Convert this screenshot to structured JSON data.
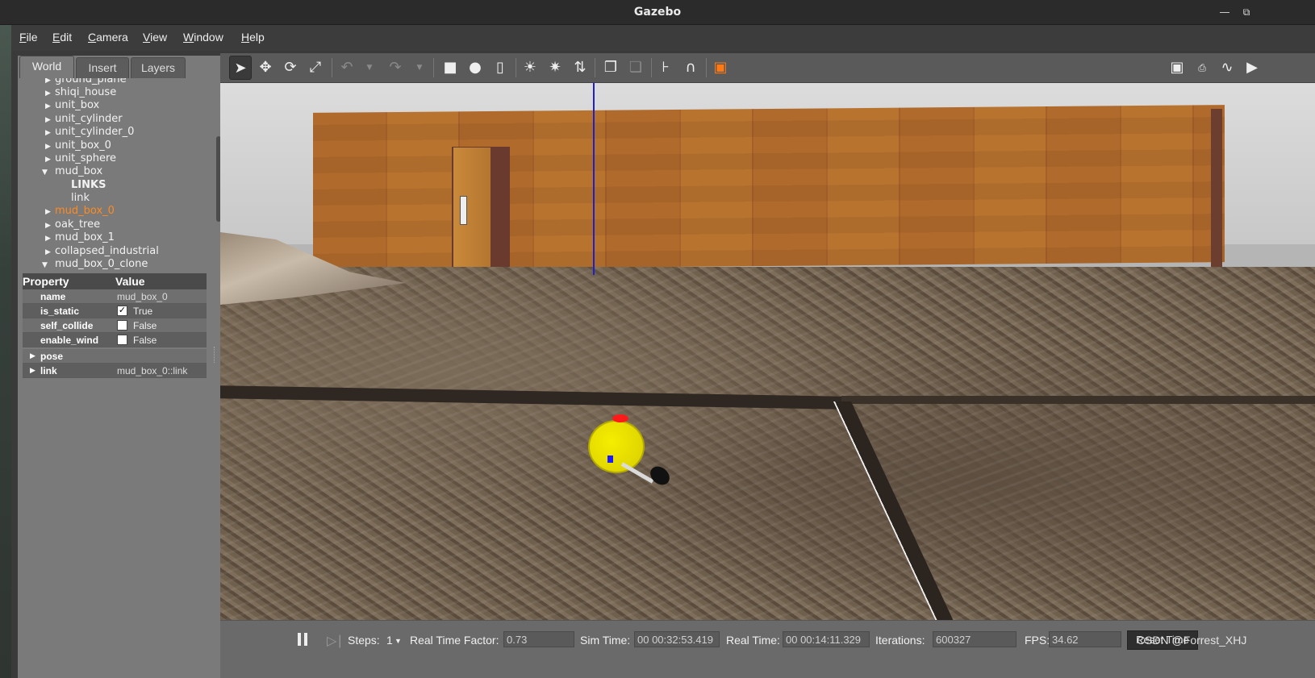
{
  "window": {
    "title": "Gazebo",
    "minimize_glyph": "―",
    "maximize_glyph": "⧉"
  },
  "menu": [
    "File",
    "Edit",
    "Camera",
    "View",
    "Window",
    "Help"
  ],
  "left_panel": {
    "tabs": [
      "World",
      "Insert",
      "Layers"
    ],
    "active_tab": "World",
    "tree": [
      {
        "label": "ground_plane",
        "expanded": false,
        "indent": 0
      },
      {
        "label": "shiqi_house",
        "expanded": false,
        "indent": 0
      },
      {
        "label": "unit_box",
        "expanded": false,
        "indent": 0
      },
      {
        "label": "unit_cylinder",
        "expanded": false,
        "indent": 0
      },
      {
        "label": "unit_cylinder_0",
        "expanded": false,
        "indent": 0
      },
      {
        "label": "unit_box_0",
        "expanded": false,
        "indent": 0
      },
      {
        "label": "unit_sphere",
        "expanded": false,
        "indent": 0
      },
      {
        "label": "mud_box",
        "expanded": true,
        "indent": 0
      },
      {
        "label": "LINKS",
        "indent": 1,
        "bold": true
      },
      {
        "label": "link",
        "indent": 1
      },
      {
        "label": "mud_box_0",
        "expanded": false,
        "indent": 0,
        "selected": true
      },
      {
        "label": "oak_tree",
        "expanded": false,
        "indent": 0
      },
      {
        "label": "mud_box_1",
        "expanded": false,
        "indent": 0
      },
      {
        "label": "collapsed_industrial",
        "expanded": false,
        "indent": 0
      },
      {
        "label": "mud_box_0_clone",
        "expanded": true,
        "indent": 0
      }
    ],
    "properties": {
      "header_property": "Property",
      "header_value": "Value",
      "rows": {
        "name": {
          "key": "name",
          "value": "mud_box_0"
        },
        "is_static": {
          "key": "is_static",
          "checked": true,
          "value": "True",
          "check": "✓"
        },
        "self_collide": {
          "key": "self_collide",
          "checked": false,
          "value": "False"
        },
        "enable_wind": {
          "key": "enable_wind",
          "checked": false,
          "value": "False"
        },
        "pose": {
          "key": "pose"
        },
        "link": {
          "key": "link",
          "value": "mud_box_0::link"
        }
      }
    }
  },
  "toolbar": {
    "icons": [
      "select-arrow-icon",
      "translate-icon",
      "rotate-icon",
      "scale-icon",
      "undo-icon",
      "redo-icon",
      "box-icon",
      "sphere-icon",
      "cylinder-icon",
      "point-light-icon",
      "spot-light-icon",
      "directional-light-icon",
      "copy-icon",
      "paste-icon",
      "align-icon",
      "snap-icon",
      "view-angle-icon",
      "screenshot-icon",
      "log-icon",
      "plot-icon",
      "video-icon"
    ]
  },
  "status": {
    "steps_label": "Steps:",
    "steps_value": "1",
    "rtf_label": "Real Time Factor:",
    "rtf_value": "0.73",
    "sim_time_label": "Sim Time:",
    "sim_time_value": "00 00:32:53.419",
    "real_time_label": "Real Time:",
    "real_time_value": "00 00:14:11.329",
    "iterations_label": "Iterations:",
    "iterations_value": "600327",
    "fps_label": "FPS:",
    "fps_value": "34.62",
    "reset_label": "Reset Time",
    "watermark": "CSDN @Forrest_XHJ"
  },
  "colors": {
    "selected_item": "#ff8a1f",
    "z_axis": "#1d22c8",
    "robot_body": "#f5ee00"
  }
}
